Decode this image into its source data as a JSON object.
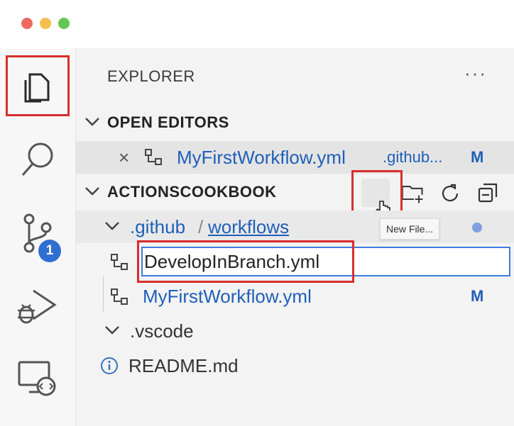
{
  "window": {
    "buttons": [
      "close",
      "minimize",
      "maximize"
    ]
  },
  "activity_bar": {
    "items": [
      {
        "name": "explorer",
        "icon": "files-icon",
        "active": true
      },
      {
        "name": "search",
        "icon": "search-icon"
      },
      {
        "name": "source-control",
        "icon": "source-control-icon",
        "badge": "1"
      },
      {
        "name": "run-debug",
        "icon": "run-debug-icon"
      },
      {
        "name": "remote-explorer",
        "icon": "remote-explorer-icon"
      }
    ]
  },
  "sidebar": {
    "title": "EXPLORER",
    "more_actions": "···",
    "open_editors": {
      "label": "OPEN EDITORS",
      "items": [
        {
          "close": "×",
          "name": "MyFirstWorkflow.yml",
          "path": ".github...",
          "status": "M"
        }
      ]
    },
    "project": {
      "label": "ACTIONSCOOKBOOK",
      "actions": [
        "new-file-icon",
        "new-folder-icon",
        "refresh-icon",
        "collapse-all-icon"
      ],
      "tooltip": "New File...",
      "folder": {
        "parent": ".github",
        "separator": "/",
        "child": "workflows"
      },
      "new_file_input_value": "DevelopInBranch.yml",
      "workflow_file": {
        "name": "MyFirstWorkflow.yml",
        "status": "M"
      },
      "vscode_folder": ".vscode",
      "readme": "README.md"
    }
  },
  "colors": {
    "accent": "#1f5fb8",
    "highlight": "#d92d2d",
    "badge": "#2f6fd1"
  }
}
